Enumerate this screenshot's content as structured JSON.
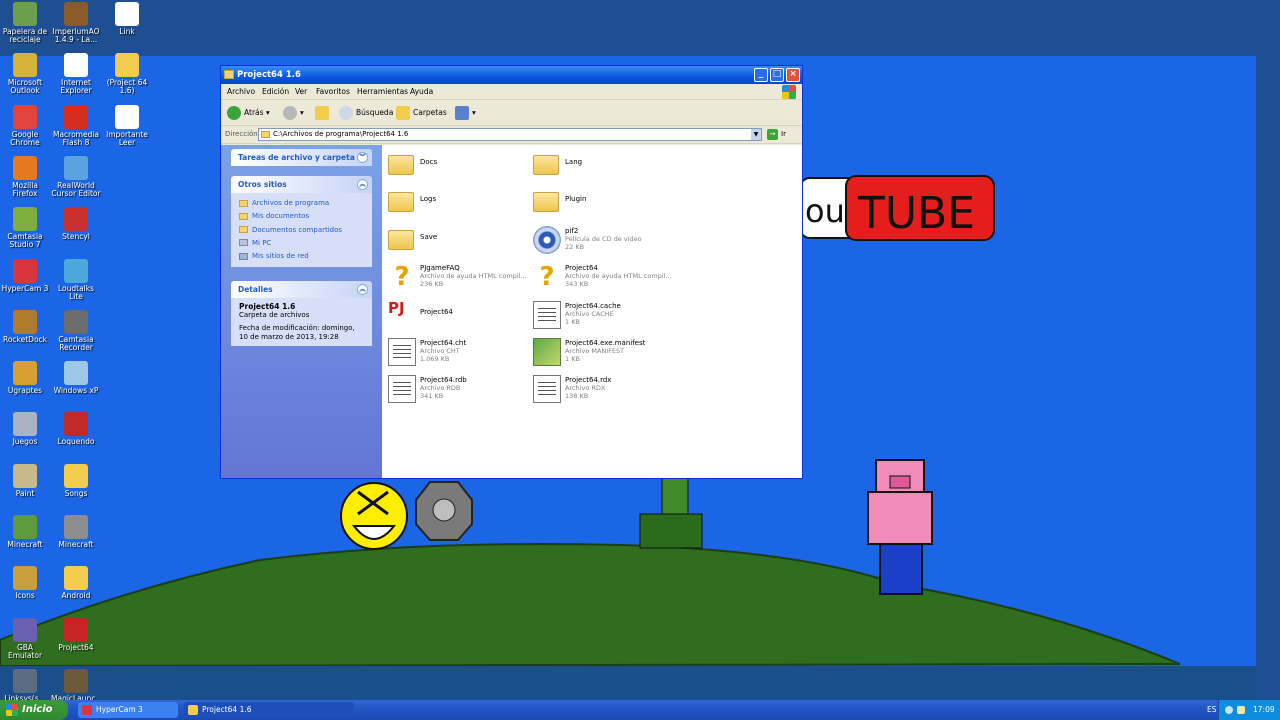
{
  "desktop": {
    "icons": [
      {
        "label": "Papelera de reciclaje",
        "icon": "recycle-bin-icon",
        "color": "#6b9e4f",
        "col": 0,
        "row": 0
      },
      {
        "label": "ImperiumAO 1.4.9 - La...",
        "icon": "game-icon",
        "color": "#8b5a2b",
        "col": 1,
        "row": 0
      },
      {
        "label": "Link",
        "icon": "document-icon",
        "color": "#ffffff",
        "col": 2,
        "row": 0
      },
      {
        "label": "Microsoft Outlook",
        "icon": "outlook-icon",
        "color": "#d4b23a",
        "col": 0,
        "row": 1
      },
      {
        "label": "Internet Explorer",
        "icon": "internet-explorer-icon",
        "color": "#ffffff",
        "col": 1,
        "row": 1
      },
      {
        "label": "(Project 64 1.6)",
        "icon": "folder-icon",
        "color": "#f2cc4d",
        "col": 2,
        "row": 1
      },
      {
        "label": "Google Chrome",
        "icon": "chrome-icon",
        "color": "#e0443a",
        "col": 0,
        "row": 2
      },
      {
        "label": "Macromedia Flash 8",
        "icon": "flash-icon",
        "color": "#d62c1f",
        "col": 1,
        "row": 2
      },
      {
        "label": "Importante Leer",
        "icon": "document-icon",
        "color": "#ffffff",
        "col": 2,
        "row": 2
      },
      {
        "label": "Mozilla Firefox",
        "icon": "firefox-icon",
        "color": "#e5791e",
        "col": 0,
        "row": 3
      },
      {
        "label": "RealWorld Cursor Editor",
        "icon": "cursor-editor-icon",
        "color": "#5aa2e0",
        "col": 1,
        "row": 3
      },
      {
        "label": "Camtasia Studio 7",
        "icon": "camtasia-icon",
        "color": "#7fae3f",
        "col": 0,
        "row": 4
      },
      {
        "label": "Stencyl",
        "icon": "stencyl-icon",
        "color": "#c9302c",
        "col": 1,
        "row": 4
      },
      {
        "label": "HyperCam 3",
        "icon": "hypercam-icon",
        "color": "#d9353f",
        "col": 0,
        "row": 5
      },
      {
        "label": "Loudtalks Lite",
        "icon": "loudtalks-icon",
        "color": "#4aa9d8",
        "col": 1,
        "row": 5
      },
      {
        "label": "RocketDock",
        "icon": "rocketdock-icon",
        "color": "#b07b2c",
        "col": 0,
        "row": 6
      },
      {
        "label": "Camtasia Recorder",
        "icon": "recorder-icon",
        "color": "#6c6c6c",
        "col": 1,
        "row": 6
      },
      {
        "label": "Ugraptes",
        "icon": "ugraptes-icon",
        "color": "#d8a030",
        "col": 0,
        "row": 7
      },
      {
        "label": "Windows xP",
        "icon": "windows-icon",
        "color": "#9ec8e8",
        "col": 1,
        "row": 7
      },
      {
        "label": "Juegos",
        "icon": "games-icon",
        "color": "#a8b4c4",
        "col": 0,
        "row": 8
      },
      {
        "label": "Loquendo",
        "icon": "loquendo-icon",
        "color": "#c22a2a",
        "col": 1,
        "row": 8
      },
      {
        "label": "Paint",
        "icon": "paint-icon",
        "color": "#c9b98a",
        "col": 0,
        "row": 9
      },
      {
        "label": "Songs",
        "icon": "folder-icon",
        "color": "#f2cc4d",
        "col": 1,
        "row": 9
      },
      {
        "label": "Minecraft",
        "icon": "minecraft-icon",
        "color": "#5f9a3c",
        "col": 0,
        "row": 10
      },
      {
        "label": "Minecraft",
        "icon": "minecraft-launcher-icon",
        "color": "#8d8d8d",
        "col": 1,
        "row": 10
      },
      {
        "label": "Icons",
        "icon": "icons-icon",
        "color": "#c89f3a",
        "col": 0,
        "row": 11
      },
      {
        "label": "Android",
        "icon": "folder-icon",
        "color": "#f2cc4d",
        "col": 1,
        "row": 11
      },
      {
        "label": "GBA Emulator",
        "icon": "gba-emulator-icon",
        "color": "#6a5fb0",
        "col": 0,
        "row": 12
      },
      {
        "label": "Project64",
        "icon": "project64-icon",
        "color": "#c62424",
        "col": 1,
        "row": 12
      },
      {
        "label": "Linksys(s...",
        "icon": "linksys-icon",
        "color": "#5b6b80",
        "col": 0,
        "row": 13
      },
      {
        "label": "MagicLaunc...",
        "icon": "magiclauncher-icon",
        "color": "#6b5a3c",
        "col": 1,
        "row": 13
      }
    ],
    "drawing": {
      "logo_text": "TUBE",
      "logo_left_text": "ou"
    }
  },
  "window": {
    "title": "Project64 1.6",
    "menus": [
      "Archivo",
      "Edición",
      "Ver",
      "Favoritos",
      "Herramientas",
      "Ayuda"
    ],
    "toolbar": {
      "back_label": "Atrás",
      "search_label": "Búsqueda",
      "folders_label": "Carpetas"
    },
    "address": {
      "label": "Dirección",
      "value": "C:\\Archivos de programa\\Project64 1.6",
      "go_label": "Ir"
    },
    "tasks_panel": {
      "file_tasks_title": "Tareas de archivo y carpeta",
      "other_places_title": "Otros sitios",
      "other_places": [
        "Archivos de programa",
        "Mis documentos",
        "Documentos compartidos",
        "Mi PC",
        "Mis sitios de red"
      ],
      "details_title": "Detalles",
      "details_name": "Project64 1.6",
      "details_type": "Carpeta de archivos",
      "details_modified": "Fecha de modificación: domingo, 10 de marzo de 2013, 19:28"
    },
    "files": [
      {
        "name": "Docs",
        "type": "",
        "size": "",
        "icon": "folder-icon",
        "kind": "folder"
      },
      {
        "name": "Lang",
        "type": "",
        "size": "",
        "icon": "folder-icon",
        "kind": "folder"
      },
      {
        "name": "Logs",
        "type": "",
        "size": "",
        "icon": "folder-icon",
        "kind": "folder"
      },
      {
        "name": "Plugin",
        "type": "",
        "size": "",
        "icon": "folder-icon",
        "kind": "folder"
      },
      {
        "name": "Save",
        "type": "",
        "size": "",
        "icon": "folder-icon",
        "kind": "folder"
      },
      {
        "name": "pif2",
        "type": "Película de CD de vídeo",
        "size": "22 KB",
        "icon": "cd-video-icon",
        "kind": "cd"
      },
      {
        "name": "PJgameFAQ",
        "type": "Archivo de ayuda HTML compil...",
        "size": "236 KB",
        "icon": "help-file-icon",
        "kind": "help"
      },
      {
        "name": "Project64",
        "type": "Archivo de ayuda HTML compil...",
        "size": "343 KB",
        "icon": "help-file-icon",
        "kind": "help"
      },
      {
        "name": "Project64",
        "type": "",
        "size": "",
        "icon": "project64-app-icon",
        "kind": "pj"
      },
      {
        "name": "Project64.cache",
        "type": "Archivo CACHE",
        "size": "1 KB",
        "icon": "generic-file-icon",
        "kind": "doc"
      },
      {
        "name": "Project64.cht",
        "type": "Archivo CHT",
        "size": "1.069 KB",
        "icon": "generic-file-icon",
        "kind": "doc"
      },
      {
        "name": "Project64.exe.manifest",
        "type": "Archivo MANIFEST",
        "size": "1 KB",
        "icon": "manifest-file-icon",
        "kind": "manifest"
      },
      {
        "name": "Project64.rdb",
        "type": "Archivo RDB",
        "size": "341 KB",
        "icon": "generic-file-icon",
        "kind": "doc"
      },
      {
        "name": "Project64.rdx",
        "type": "Archivo RDX",
        "size": "138 KB",
        "icon": "generic-file-icon",
        "kind": "doc"
      }
    ]
  },
  "taskbar": {
    "start_label": "Inicio",
    "tasks": [
      {
        "label": "HyperCam 3",
        "icon": "hypercam-icon",
        "color": "#d9353f"
      },
      {
        "label": "Project64 1.6",
        "icon": "folder-icon",
        "color": "#f2cc4d"
      }
    ],
    "language": "ES",
    "clock": "17:09"
  }
}
